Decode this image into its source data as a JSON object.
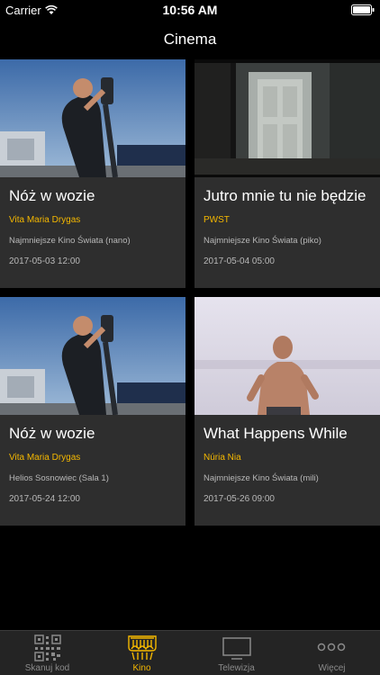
{
  "status_bar": {
    "carrier": "Carrier",
    "time": "10:56 AM"
  },
  "nav": {
    "title": "Cinema"
  },
  "cards": [
    {
      "title": "Nóż w wozie",
      "director": "Vita Maria Drygas",
      "venue": "Najmniejsze Kino Świata (nano)",
      "date": "2017-05-03 12:00",
      "image": "man-with-sledgehammer"
    },
    {
      "title": "Jutro mnie tu nie będzie",
      "director": "PWST",
      "venue": "Najmniejsze Kino Świata (piko)",
      "date": "2017-05-04 05:00",
      "image": "open-door-hallway"
    },
    {
      "title": "Nóż w wozie",
      "director": "Vita Maria Drygas",
      "venue": "Helios Sosnowiec (Sala 1)",
      "date": "2017-05-24 12:00",
      "image": "man-with-sledgehammer"
    },
    {
      "title": "What Happens While",
      "director": "Núria Nia",
      "venue": "Najmniejsze Kino Świata (mili)",
      "date": "2017-05-26 09:00",
      "image": "shirtless-man-snow"
    }
  ],
  "tabs": [
    {
      "label": "Skanuj kod",
      "icon": "qr-code-icon",
      "active": false
    },
    {
      "label": "Kino",
      "icon": "cinema-icon",
      "active": true
    },
    {
      "label": "Telewizja",
      "icon": "tv-icon",
      "active": false
    },
    {
      "label": "Więcej",
      "icon": "more-icon",
      "active": false
    }
  ],
  "colors": {
    "accent": "#f5b800",
    "card_background": "#2e2e2e",
    "background": "#000000",
    "tab_bar": "#242424"
  }
}
